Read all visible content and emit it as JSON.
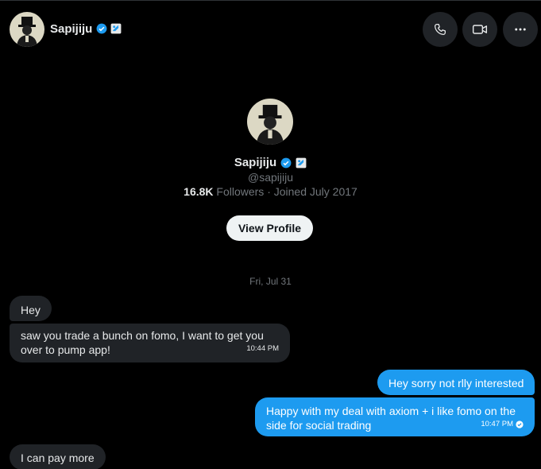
{
  "header": {
    "name": "Sapijiju",
    "icons": [
      "verified-badge-icon",
      "affiliate-badge-icon",
      "phone-icon",
      "video-icon",
      "more-icon"
    ]
  },
  "profile": {
    "name": "Sapijiju",
    "handle": "@sapijiju",
    "followers_count": "16.8K",
    "followers_text": " Followers · Joined July 2017",
    "view_profile_label": "View Profile"
  },
  "date_separator": "Fri, Jul 31",
  "messages": [
    {
      "direction": "incoming",
      "text": "Hey"
    },
    {
      "direction": "incoming",
      "text": "saw you trade a bunch on fomo, I want to get you over to pump app!",
      "time": "10:44 PM"
    },
    {
      "direction": "outgoing",
      "text": "Hey sorry not rlly interested"
    },
    {
      "direction": "outgoing",
      "text": "Happy with my deal with axiom + i like fomo on the side for social trading",
      "time": "10:47 PM"
    },
    {
      "direction": "incoming",
      "text": "I can pay more"
    }
  ],
  "colors": {
    "background": "#000000",
    "incoming_bubble": "#202327",
    "outgoing_bubble": "#1d9bf0",
    "verified": "#1d9bf0",
    "muted_text": "#71767b"
  }
}
